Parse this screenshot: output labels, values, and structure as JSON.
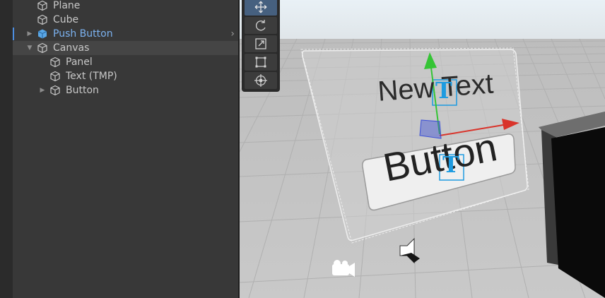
{
  "hierarchy": {
    "items": [
      {
        "label": "Plane",
        "selected": false,
        "expandable": false
      },
      {
        "label": "Cube",
        "selected": false,
        "expandable": false
      },
      {
        "label": "Push Button",
        "selected": true,
        "expandable": true,
        "expanded": false
      },
      {
        "label": "Canvas",
        "selected": false,
        "expandable": true,
        "expanded": true
      },
      {
        "label": "Panel",
        "selected": false,
        "expandable": false
      },
      {
        "label": "Text (TMP)",
        "selected": false,
        "expandable": false
      },
      {
        "label": "Button",
        "selected": false,
        "expandable": true,
        "expanded": false
      }
    ]
  },
  "toolbar": {
    "tools": [
      {
        "icon": "move-tool-icon",
        "active": true
      },
      {
        "icon": "rotate-tool-icon",
        "active": false
      },
      {
        "icon": "scale-tool-icon",
        "active": false
      },
      {
        "icon": "rect-tool-icon",
        "active": false
      },
      {
        "icon": "transform-tool-icon",
        "active": false
      }
    ]
  },
  "scene": {
    "canvas_text": "New Text",
    "button_text": "Button",
    "gizmo_colors": {
      "y_axis": "#35c435",
      "x_axis": "#d9342b",
      "plane_handle": "#3b4fd6",
      "selection": "#1e9be0"
    }
  }
}
